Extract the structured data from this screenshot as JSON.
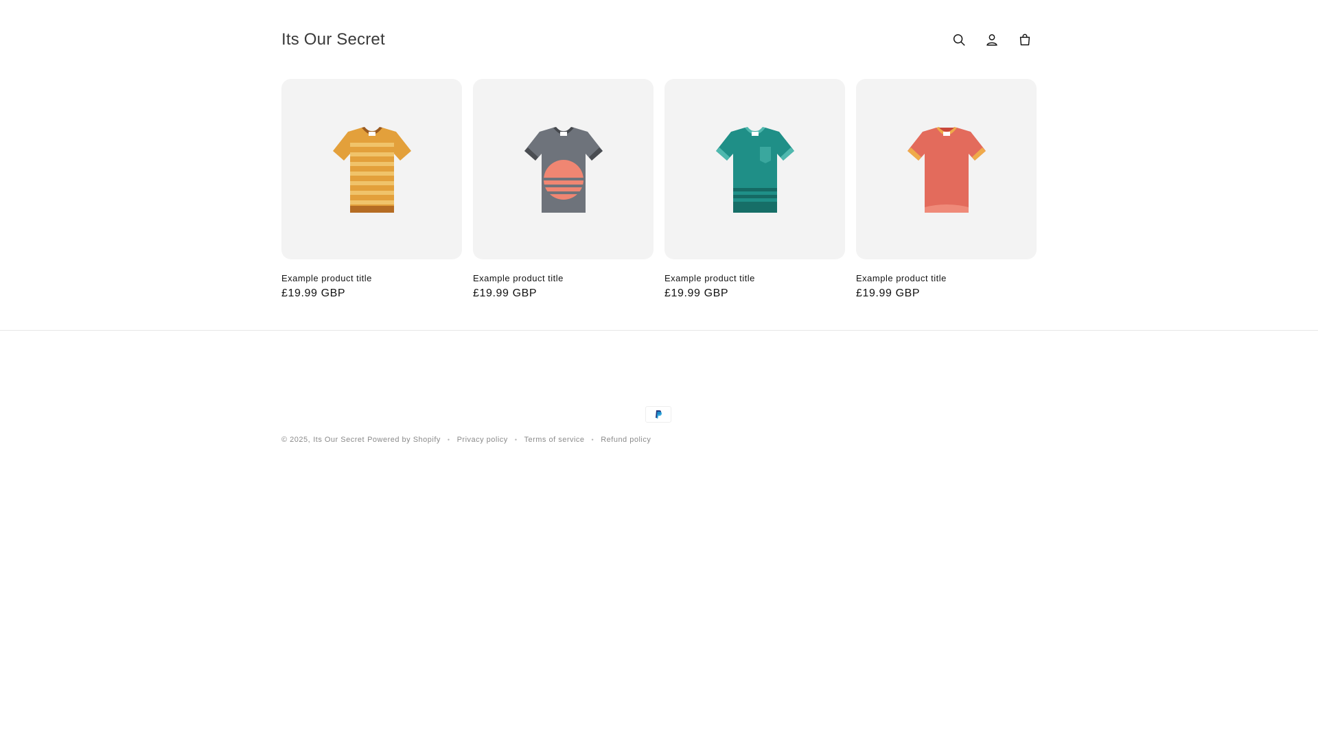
{
  "header": {
    "logo": "Its Our Secret",
    "icons": [
      "search-icon",
      "account-icon",
      "cart-icon"
    ]
  },
  "products": [
    {
      "title": "Example product title",
      "price": "£19.99 GBP",
      "image": "tshirt-orange-striped"
    },
    {
      "title": "Example product title",
      "price": "£19.99 GBP",
      "image": "tshirt-gray-sunset"
    },
    {
      "title": "Example product title",
      "price": "£19.99 GBP",
      "image": "tshirt-teal-pocket"
    },
    {
      "title": "Example product title",
      "price": "£19.99 GBP",
      "image": "tshirt-coral-ringer"
    }
  ],
  "footer": {
    "payment_icon": "paypal-icon",
    "copyright": "© 2025,",
    "store_link": "Its Our Secret",
    "powered_by": "Powered by Shopify",
    "policy_links": [
      "Privacy policy",
      "Terms of service",
      "Refund policy"
    ]
  },
  "colors": {
    "tile_background": "#f3f3f3",
    "text": "#121212",
    "muted_text": "#8a8a8a",
    "divider": "#e6e6e6"
  }
}
